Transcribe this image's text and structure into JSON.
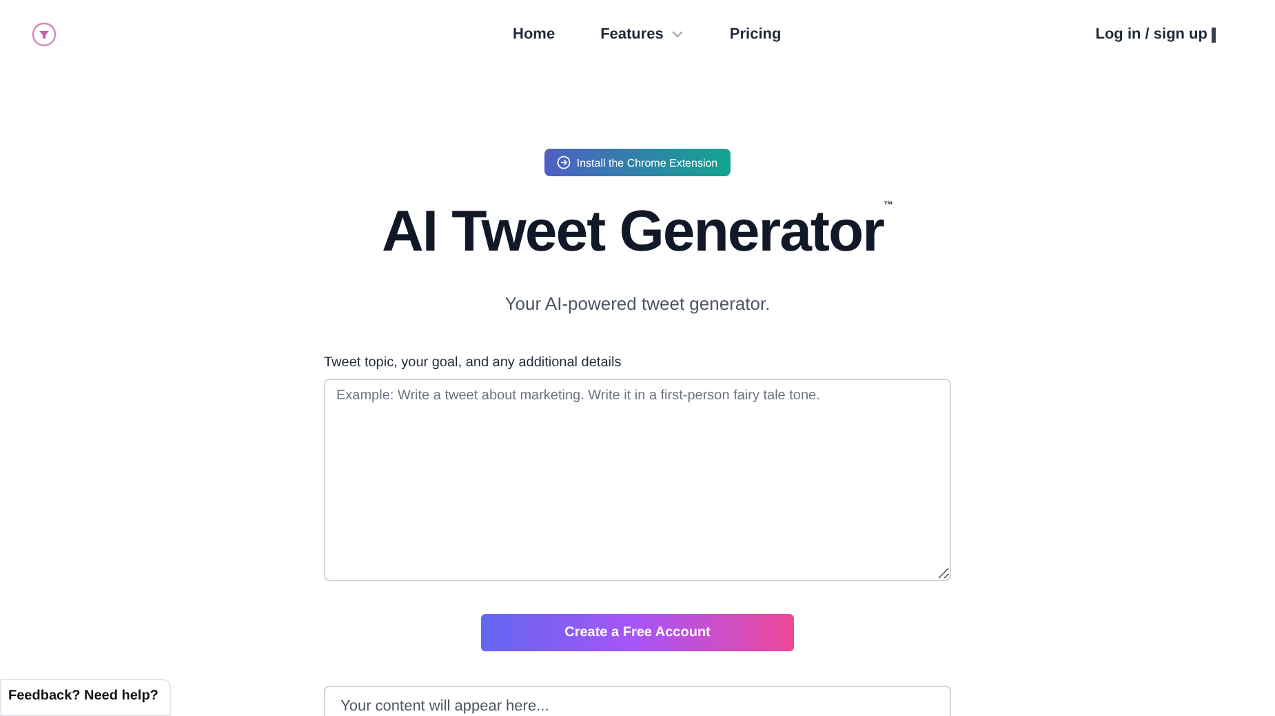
{
  "nav": {
    "items": [
      {
        "label": "Home",
        "dropdown": false
      },
      {
        "label": "Features",
        "dropdown": true
      },
      {
        "label": "Pricing",
        "dropdown": false
      }
    ],
    "login": "Log in / sign up"
  },
  "badge": "Install the Chrome Extension",
  "title": "AI Tweet Generator",
  "trademark": "™",
  "subtitle": "Your AI-powered tweet generator.",
  "field": {
    "label": "Tweet topic, your goal, and any additional details",
    "placeholder": "Example: Write a tweet about marketing. Write it in a first-person fairy tale tone."
  },
  "cta": "Create a Free Account",
  "output": {
    "placeholder": "Your content will appear here..."
  },
  "feedback": "Feedback? Need help?"
}
